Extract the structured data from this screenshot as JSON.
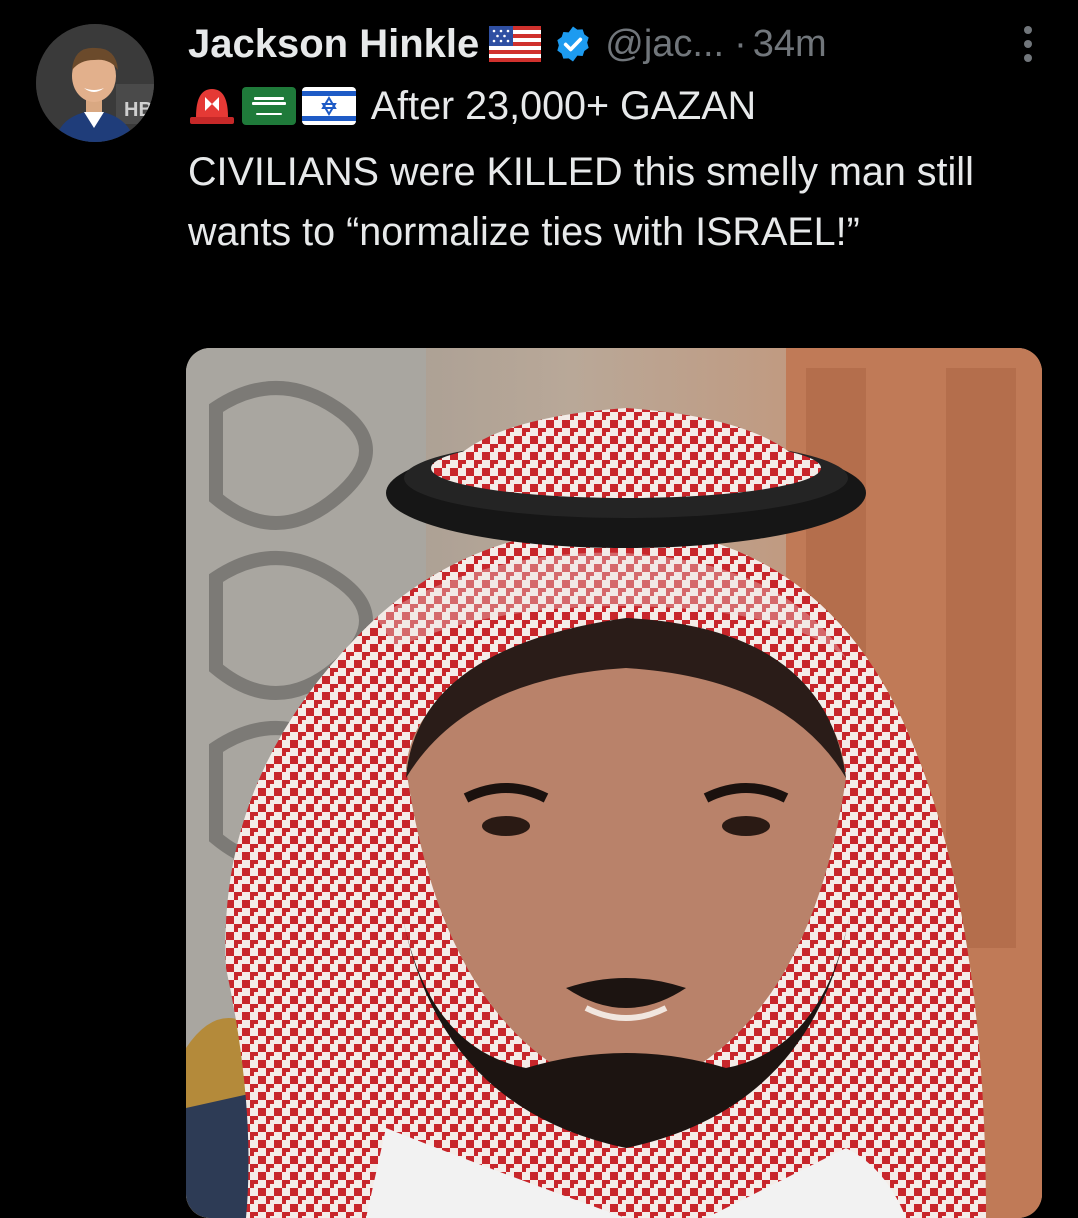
{
  "tweet": {
    "author": {
      "display_name": "Jackson Hinkle",
      "handle": "@jac...",
      "flag_emoji": "us-flag",
      "verified": true,
      "verified_color": "#1d9bf0"
    },
    "separator": "·",
    "timestamp": "34m",
    "more_icon": "more-vertical-icon",
    "emojis": [
      "siren-icon",
      "saudi-flag",
      "israel-flag"
    ],
    "text_line1": " After 23,000+ GAZAN",
    "text_rest": "CIVILIANS were KILLED this smelly man still wants to “normalize ties with ISRAEL!”",
    "media": {
      "type": "photo",
      "subject": "man wearing red-and-white checkered keffiyeh with black agal"
    }
  },
  "colors": {
    "background": "#000000",
    "primary_text": "#e7e9ea",
    "secondary_text": "#71767b",
    "accent": "#1d9bf0"
  }
}
